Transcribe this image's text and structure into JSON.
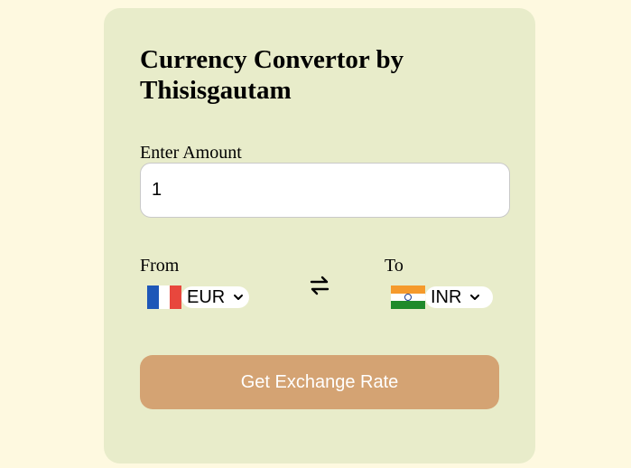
{
  "title": "Currency Convertor by Thisisgautam",
  "amount": {
    "label": "Enter Amount",
    "value": "1"
  },
  "from": {
    "label": "From",
    "selected": "EUR",
    "flag": "france-flag-icon"
  },
  "to": {
    "label": "To",
    "selected": "INR",
    "flag": "india-flag-icon"
  },
  "swap_icon": "swap-arrows-icon",
  "button": {
    "label": "Get Exchange Rate"
  },
  "colors": {
    "page_background": "#fef9e0",
    "card_background": "#e8ecca",
    "button_background": "#d4a373",
    "button_text": "#ffffff"
  }
}
